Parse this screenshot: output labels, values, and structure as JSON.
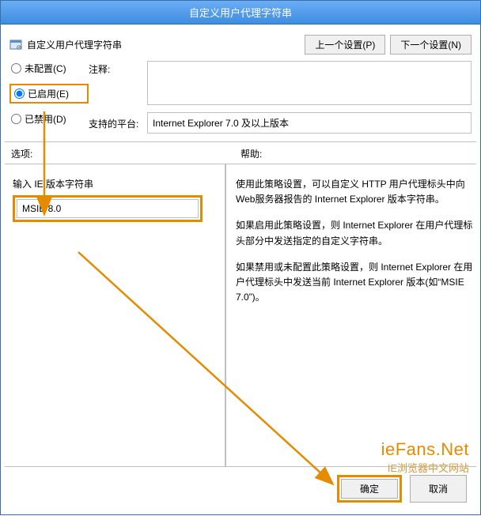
{
  "window": {
    "title": "自定义用户代理字符串"
  },
  "header": {
    "subtitle": "自定义用户代理字符串",
    "prev_btn": "上一个设置(P)",
    "next_btn": "下一个设置(N)"
  },
  "radios": {
    "not_configured": "未配置(C)",
    "enabled": "已启用(E)",
    "disabled": "已禁用(D)"
  },
  "labels": {
    "comment": "注释:",
    "platform": "支持的平台:",
    "options": "选项:",
    "help": "帮助:",
    "ie_version_label": "输入 IE 版本字符串"
  },
  "fields": {
    "comment_value": "",
    "platform_value": "Internet Explorer 7.0 及以上版本",
    "ie_version_value": "MSIE 8.0"
  },
  "help_text": {
    "p1": "使用此策略设置，可以自定义 HTTP 用户代理标头中向 Web服务器报告的 Internet Explorer 版本字符串。",
    "p2": "如果启用此策略设置，则 Internet Explorer 在用户代理标头部分中发送指定的自定义字符串。",
    "p3": "如果禁用或未配置此策略设置，则 Internet Explorer 在用户代理标头中发送当前 Internet Explorer 版本(如“MSIE 7.0”)。"
  },
  "buttons": {
    "ok": "确定",
    "cancel": "取消"
  },
  "watermark": {
    "line1": "ieFans.Net",
    "line2": "IE浏览器中文网站"
  }
}
